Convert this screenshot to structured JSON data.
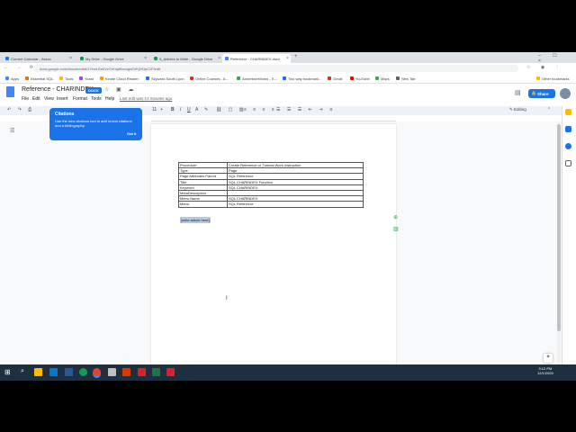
{
  "browser": {
    "tabs": [
      {
        "label": "Current Calendar - Assoc",
        "color": "#1a73e8"
      },
      {
        "label": "My Drive - Google Drive",
        "color": "#0f9d58"
      },
      {
        "label": "0_Articles to Write - Google Drive",
        "color": "#0f9d58"
      },
      {
        "label": "Reference - CHARINDEX.docx",
        "color": "#4285f4"
      }
    ],
    "url": "docs.google.com/document/d/1YbeLSsKVz7vKiqdBxcugs0VKjHfJpC1F/edit",
    "bookmarks": [
      {
        "label": "Apps",
        "color": "#4285f4"
      },
      {
        "label": "Essential SQL",
        "color": "#e8710a"
      },
      {
        "label": "Tools",
        "color": "#fbbc04"
      },
      {
        "label": "Yoast",
        "color": "#a142f4"
      },
      {
        "label": "Kindle Cloud Reader",
        "color": "#ff9900"
      },
      {
        "label": "Skyward South Lyon",
        "color": "#1a73e8"
      },
      {
        "label": "Online Courses - A...",
        "color": "#d93025"
      },
      {
        "label": "AdvertiserWorks - S...",
        "color": "#34a853"
      },
      {
        "label": "Two way bookmark...",
        "color": "#1a73e8"
      },
      {
        "label": "Gmail",
        "color": "#d93025"
      },
      {
        "label": "YouTube",
        "color": "#ff0000"
      },
      {
        "label": "Maps",
        "color": "#34a853"
      },
      {
        "label": "New Tab",
        "color": "#5f6368"
      }
    ],
    "other_bookmarks": "Other bookmarks"
  },
  "doc": {
    "title": "Reference - CHARINDEX",
    "badge": "DOCX",
    "menus": [
      "File",
      "Edit",
      "View",
      "Insert",
      "Format",
      "Tools",
      "Help"
    ],
    "last_edit": "Last edit was 13 minutes ago",
    "share_label": "Share",
    "mode_label": "Editing",
    "toolbar_zoom": "11",
    "table": [
      [
        "Procedure",
        "Create Reference or Tutorial Work Instruction"
      ],
      [
        "Type",
        "Page"
      ],
      [
        "Page Attributes Parent",
        "SQL Reference"
      ],
      [
        "Title",
        "SQL CHARINDEX Function"
      ],
      [
        "Keyword",
        "SQL CHARINDEX"
      ],
      [
        "MetaDescription",
        ""
      ],
      [
        "Menu Name",
        "SQL CHARINDEX"
      ],
      [
        "Menu",
        "SQL Reference"
      ]
    ],
    "placeholder": "[write article here]"
  },
  "popup": {
    "title": "Citations",
    "body": "Use the new citations tool to add in-text citations and a bibliography.",
    "button": "Got it"
  },
  "taskbar": {
    "time": "9:12 PM",
    "date": "12/1/2020"
  },
  "colors": {
    "accent": "#1a73e8",
    "taskbar": "#1f2f3f"
  }
}
